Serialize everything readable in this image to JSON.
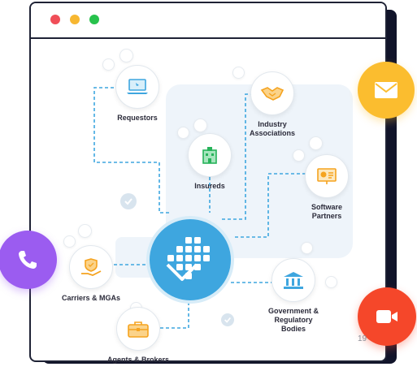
{
  "window": {
    "dot_colors": [
      "#f04e58",
      "#f7b731",
      "#27c24c"
    ]
  },
  "nodes": {
    "requestors": {
      "label": "Requestors",
      "icon": "laptop-icon"
    },
    "industry": {
      "label": "Industry\nAssociations",
      "icon": "handshake-icon"
    },
    "insureds": {
      "label": "Insureds",
      "icon": "building-icon"
    },
    "software": {
      "label": "Software\nPartners",
      "icon": "presentation-icon"
    },
    "carriers": {
      "label": "Carriers & MGAs",
      "icon": "hand-shield-icon"
    },
    "government": {
      "label": "Government &\nRegulatory\nBodies",
      "icon": "bank-icon"
    },
    "agents": {
      "label": "Agents & Brokers",
      "icon": "briefcase-icon"
    }
  },
  "floating_actions": {
    "email": {
      "icon": "email-icon",
      "color": "#fbbd2f"
    },
    "phone": {
      "icon": "phone-icon",
      "color": "#9b5cf0"
    },
    "video": {
      "icon": "video-icon",
      "color": "#f5472a"
    }
  },
  "corner_text": "19",
  "colors": {
    "accent_blue": "#3ea6df",
    "orange_icon": "#f5a31f",
    "blue_icon": "#3ea6df"
  }
}
